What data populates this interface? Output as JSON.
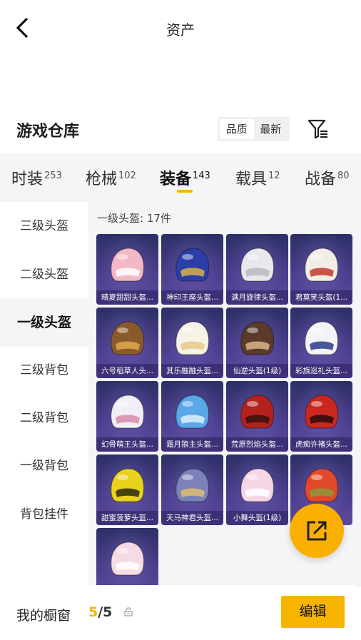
{
  "header": {
    "title": "资产"
  },
  "section": {
    "title": "游戏仓库",
    "sort_options": [
      "品质",
      "最新"
    ],
    "active_sort": "品质"
  },
  "tabs": [
    {
      "label": "时装",
      "count": "253",
      "active": false
    },
    {
      "label": "枪械",
      "count": "102",
      "active": false
    },
    {
      "label": "装备",
      "count": "143",
      "active": true
    },
    {
      "label": "载具",
      "count": "12",
      "active": false
    },
    {
      "label": "战备",
      "count": "80",
      "active": false
    }
  ],
  "subcategories": [
    {
      "label": "三级头盔",
      "active": false
    },
    {
      "label": "二级头盔",
      "active": false
    },
    {
      "label": "一级头盔",
      "active": true
    },
    {
      "label": "三级背包",
      "active": false
    },
    {
      "label": "二级背包",
      "active": false
    },
    {
      "label": "一级背包",
      "active": false
    },
    {
      "label": "背包挂件",
      "active": false
    }
  ],
  "panel": {
    "header": "一级头盔: 17件",
    "items": [
      {
        "name": "晴夏甜甜头盔...",
        "color": "#f2b8c6",
        "accent": "#ffffff"
      },
      {
        "name": "神印王座头盔...",
        "color": "#2b3ea8",
        "accent": "#d8b04a"
      },
      {
        "name": "满月旋律头盔...",
        "color": "#e8e8ec",
        "accent": "#b9b9c2"
      },
      {
        "name": "君莫笑头盔(1...",
        "color": "#f2ede6",
        "accent": "#c0392b"
      },
      {
        "name": "六号稻草人头...",
        "color": "#8a5a2b",
        "accent": "#e2a94a"
      },
      {
        "name": "其乐融融头盔...",
        "color": "#f6f2e6",
        "accent": "#e8c98a"
      },
      {
        "name": "仙逆头盔(1级)",
        "color": "#5a3b2a",
        "accent": "#d9b48a"
      },
      {
        "name": "彩旗巡礼头盔...",
        "color": "#f4f4f6",
        "accent": "#2a3a8a"
      },
      {
        "name": "幻骨萌王头盔...",
        "color": "#f2eef6",
        "accent": "#d88aa8"
      },
      {
        "name": "霜月狼主头盔...",
        "color": "#5aa8e8",
        "accent": "#dff0ff"
      },
      {
        "name": "荒原烈焰头盔...",
        "color": "#b3221c",
        "accent": "#3a1010"
      },
      {
        "name": "虎痴许褚头盔...",
        "color": "#c8281e",
        "accent": "#2a0a0a"
      },
      {
        "name": "甜蜜菠萝头盔...",
        "color": "#e8d21a",
        "accent": "#2a2a10"
      },
      {
        "name": "天马神君头盔...",
        "color": "#7a82b8",
        "accent": "#e0c070"
      },
      {
        "name": "小舞头盔(1级)",
        "color": "#f4d6e6",
        "accent": "#ffffff"
      },
      {
        "name": "",
        "color": "#e04a2a",
        "accent": "#8a9a3a"
      },
      {
        "name": "",
        "color": "#f6dbe4",
        "accent": "#ffffff"
      }
    ]
  },
  "bottom": {
    "label": "我的橱窗",
    "current": "5",
    "total": "/5",
    "edit_label": "编辑"
  },
  "icons": {
    "back": "chevron-left-icon",
    "filter": "filter-icon",
    "lock": "lock-icon",
    "share": "share-icon"
  }
}
